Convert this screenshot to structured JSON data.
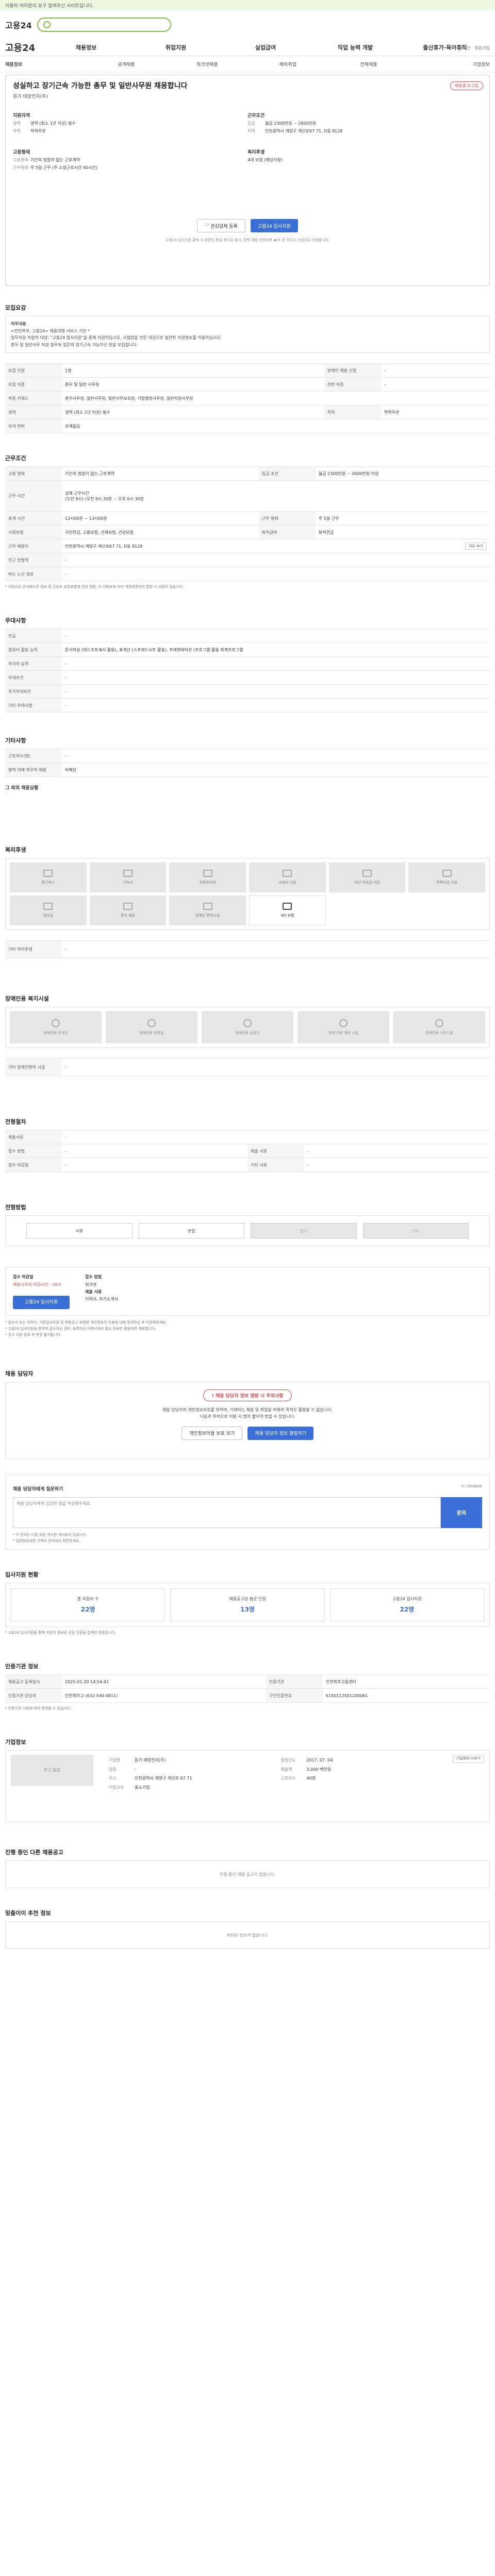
{
  "notice": "이용자 여러분의 요구 참여하신 사이트입니다.",
  "header": {
    "logo": "고용24",
    "search_placeholder": "",
    "top_links": "로그인 · 회원가입"
  },
  "gnb": {
    "logo": "고용24",
    "items": [
      "채용정보",
      "취업지원",
      "실업급여",
      "직업 능력 개발",
      "출산휴가·육아휴직"
    ]
  },
  "subnav": [
    "채용정보",
    "공개채용",
    "워크넷채용",
    "해외취업",
    "전체채용",
    "기업정보"
  ],
  "job": {
    "title": "성실하고 장기근속 가능한 총무 및 일반사무원 채용합니다",
    "company": "원가 태양전자(주)",
    "badge": "채용중 D-2일",
    "left_header": "지원자격",
    "left": [
      {
        "k": "경력",
        "v": "경력 (최소 1년 이상) 필수"
      },
      {
        "k": "학력",
        "v": "학력무관"
      }
    ],
    "left2_header": "고용형태",
    "left2": [
      {
        "k": "고용형태",
        "v": "기간의 정함이 없는 근로계약"
      },
      {
        "k": "근무형태",
        "v": "주 5일 근무 (주 소정근로시간 40시간)"
      }
    ],
    "right_header": "근무조건",
    "right": [
      {
        "k": "임금",
        "v": "월급 2300만원 ~ 2600만원"
      },
      {
        "k": "지역",
        "v": "인천광역시 계양구 계산로67 71, D동 8128"
      }
    ],
    "right2_header": "복리후생",
    "right2": [
      {
        "k": "",
        "v": "4대 보험 (해당사항)"
      }
    ],
    "btn_interest": "관심업체 등록",
    "btn_apply": "고용24 입사지원",
    "note": "고용24 입사지원 클릭 시 화면이 동일 창으로 표시, 전택 채용 신청되며 ◀ 주 등 이으시 지원처로 이동합니다."
  },
  "recruit": {
    "title": "모집요강",
    "job_desc_h": "직무내용",
    "job_desc": [
      "<전민복부, 고용24> 채용대행 서비스 기간 *",
      "업무지원 적합적 대상: \"고용24 업사지원\"을 통해 지원하십시오. 사업장을 전문 대상으로 일관한 지원정보를 이용하십시오.",
      "총무 및 일반사무 직원 업무와 업문의 장기근속 가능하신 분을 모집합니다."
    ],
    "rows": [
      [
        {
          "h": "모집 인원",
          "v": "1명"
        },
        {
          "h": "장애인 채용 신청",
          "v": "-"
        }
      ],
      [
        {
          "h": "모집 직종",
          "v": "총무 및 일반 사무원"
        },
        {
          "h": "관련 직종",
          "v": "-"
        }
      ],
      [
        {
          "h": "직종 키워드",
          "v": "총무사무원, 일반사무원, 일반사무보조원, 기업행정사무원, 일반지원사무원"
        },
        {
          "h": "",
          "v": ""
        }
      ],
      [
        {
          "h": "경력",
          "v": "경력 (최소 1년 이상) 필수"
        },
        {
          "h": "학력",
          "v": "학력무관"
        }
      ],
      [
        {
          "h": "자격 면허",
          "v": "관계없음"
        },
        {
          "h": "",
          "v": ""
        }
      ]
    ]
  },
  "conditions": {
    "title": "근무조건",
    "rows": [
      [
        {
          "h": "고용 형태",
          "v": "기간의 정함이 없는 근로계약"
        },
        {
          "h": "임금 조건",
          "v": "월급 2300만원 ~ 2600만원 이상"
        }
      ],
      [
        {
          "h": "근무 시간",
          "v": "실제 근무시간\n(오전 9시) (오전 9시 30분 ~ 오후 6시 30분"
        },
        {
          "h": "",
          "v": ""
        }
      ],
      [
        {
          "h": "휴게 시간",
          "v": "12시00분 ~ 13시00분"
        },
        {
          "h": "근무 형태",
          "v": "주 5일 근무"
        }
      ],
      [
        {
          "h": "사회보험",
          "v": "국민연금, 고용보험, 산재보험, 건강보험"
        },
        {
          "h": "퇴직급여",
          "v": "퇴직연금"
        }
      ],
      [
        {
          "h": "근무 예정지",
          "v": "인천광역시 계양구 계산로67 71, D동 8128"
        },
        {
          "h": "",
          "v": "지도 보기"
        }
      ],
      [
        {
          "h": "인근 전철역",
          "v": "-"
        },
        {
          "h": "",
          "v": ""
        }
      ],
      [
        {
          "h": "버스 노선 정보",
          "v": "-"
        },
        {
          "h": "",
          "v": ""
        }
      ]
    ],
    "note": "* 지원으로 안내해드린 정보 및 근로조 조회표합에 관한 정합, 타 이용표에 따라 계정변경되어 향방 나 사람이 있습니다."
  },
  "preferred": {
    "title": "우대사항",
    "rows": [
      [
        {
          "h": "전공",
          "v": "-"
        }
      ],
      [
        {
          "h": "컴퓨터 활용 능력",
          "v": "문서작성 (워드프로세서 활용), 표계산 (스프레드시트 활용), 프레젠테이션 (프로그램 활용 회계프로그램"
        }
      ],
      [
        {
          "h": "외국어 능력",
          "v": "-"
        }
      ],
      [
        {
          "h": "우대조건",
          "v": "-"
        }
      ],
      [
        {
          "h": "추가우대조건",
          "v": "-"
        }
      ],
      [
        {
          "h": "기타 우대사항",
          "v": "-"
        }
      ]
    ]
  },
  "misc": {
    "title": "기타사항",
    "rows": [
      [
        {
          "h": "근로자수(명)",
          "v": "-"
        }
      ],
      [
        {
          "h": "병역 대체 복무자 채용",
          "v": "비해당"
        }
      ]
    ],
    "note": "그 외의 채용상황",
    "note_v": "-"
  },
  "welfare": {
    "title": "복리후생",
    "tiles": [
      {
        "label": "통근버스",
        "on": false
      },
      {
        "label": "기숙사",
        "on": false
      },
      {
        "label": "차량유지비",
        "on": false
      },
      {
        "label": "교육비 지원",
        "on": false
      },
      {
        "label": "자녀 학자금 지원",
        "on": false
      },
      {
        "label": "주택자금 지원",
        "on": false
      },
      {
        "label": "경조금",
        "on": false
      },
      {
        "label": "중식 제공",
        "on": false
      },
      {
        "label": "장애인 편의시설",
        "on": false
      },
      {
        "label": "4대 보험",
        "on": true
      }
    ],
    "extra_h": "기타 복리후생",
    "extra_v": "-"
  },
  "facility": {
    "title": "장애인용 복지시설",
    "tiles": [
      "장애인용 주차장",
      "장애인용 화장실",
      "장애인용 승강기",
      "장애 지원 제공 시설",
      "장애인용 기타시설"
    ],
    "extra_h": "기타 장애인편의 시설",
    "extra_v": "-"
  },
  "selection": {
    "title": "전형절차",
    "steps": [
      {
        "label": "서류",
        "on": true
      },
      {
        "label": "면접",
        "on": true
      },
      {
        "label": "필기",
        "on": false
      },
      {
        "label": "기타",
        "on": false
      }
    ],
    "rows": [
      [
        {
          "h": "제출서류",
          "v": "-"
        }
      ],
      [
        {
          "h": "접수 방법",
          "v": "-"
        }
      ],
      [
        {
          "h": "제출 서류",
          "v": "-"
        }
      ],
      [
        {
          "h": "접수 마감일",
          "v": "-"
        }
      ],
      [
        {
          "h": "기타 서류",
          "v": "-"
        }
      ]
    ]
  },
  "receipt": {
    "title": "전형방법",
    "steps": [
      {
        "label": "서류",
        "on": true
      },
      {
        "label": "면접",
        "on": true
      },
      {
        "label": "필기",
        "on": false
      },
      {
        "label": "기타",
        "on": false
      }
    ]
  },
  "apply": {
    "period_h": "접수 마감일",
    "period_v": "채용시까지 마감시간 : 26시",
    "method_h": "접수 방법",
    "method_v": "워크넷",
    "docs_h": "제출 서류",
    "docs_v": "이력서, 자기소개서",
    "btn": "고용24 입사지원",
    "notes": [
      "* 접수서 또는 이력서, 기준입사지원 및 채용공고 포함한 개인정보의 이용에 대해 동의하신 후 지원해주세요.",
      "* 고용24 입사지원을 통하여 접수하신 경우, 등록하신 이력서에서 필요 정보만 활용하여 채용합니다.",
      "* 공고 지원 완료 후 변경 불가합니다."
    ]
  },
  "manager": {
    "title": "채용 담당자",
    "notice": "채용 담당자 정보 열람 시 주의사항",
    "desc": "채용 담당자의 개인정보보호를 위하여, 기재되는 채용 및 취업을 외에의 목적은 활용할 수 없습니다.\n다음과 목적으로 이용 시 법적 불이익 받을 수 있습니다.",
    "btn_view": "개인정보이용 보호 보기",
    "btn_agree": "채용 담당자 정보 열람하기"
  },
  "qna": {
    "title": "채용 담당자에게 질문하기",
    "placeholder": "채용 담당자에게 궁금한 점을 작성해주세요.",
    "count": "0 / 500byte",
    "btn": "문의",
    "notes": [
      "* 이 문의는 다른 회원 게시판 게시되지 않습니다.",
      "* 답변완료되면 이력서 관리에서 확인하세요."
    ]
  },
  "stats": {
    "title": "입사지원 현황",
    "items": [
      {
        "label": "총 지원자 수",
        "n": "22명"
      },
      {
        "label": "채용공고당 평균 인원",
        "n": "13명"
      },
      {
        "label": "고용24 입사지원",
        "n": "22명"
      }
    ],
    "note": "* 고용24 입사지원을 통해 지원자 정보로 지원 인원을 집계한 현황입니다."
  },
  "info": {
    "title": "인증기관 정보",
    "rows": [
      [
        {
          "h": "채용공고 등록일시",
          "v": "2025-01-20 14:54:42"
        },
        {
          "h": "인증기관",
          "v": "인천북부고용센터"
        }
      ],
      [
        {
          "h": "인증기관 담당자",
          "v": "인천북부고 (032-540-0811)"
        },
        {
          "h": "구인인증번호",
          "v": "K150112501200061"
        }
      ]
    ],
    "notes": [
      "* 인증기관 이용에 따라 변경될 수 있습니다."
    ]
  },
  "company_info": {
    "title": "기업정보",
    "logo_text": "로고 없음",
    "rows": [
      {
        "h": "기업명",
        "v": "원가 태양전자(주)"
      },
      {
        "h": "업종",
        "v": "-"
      },
      {
        "h": "주소",
        "v": "인천광역시 계양구 계산로 67 71"
      },
      {
        "h": "기업규모",
        "v": "중소기업"
      }
    ],
    "rows2": [
      {
        "h": "설립년도",
        "v": "2017. 07. 04"
      },
      {
        "h": "매출액",
        "v": "3,000 백만원"
      },
      {
        "h": "근로자수",
        "v": "40명"
      }
    ],
    "btn_more": "기업정보 더보기"
  },
  "other": {
    "title": "진행 중인 다른 채용공고",
    "empty": "진행 중인 채용 공고가 없습니다."
  },
  "rec": {
    "title": "맞춤이이 추천 정보",
    "empty": "추천된 정보가 없습니다."
  },
  "colors": {
    "accent": "#3b6fd8",
    "green": "#7bc043",
    "red": "#e0474c"
  }
}
